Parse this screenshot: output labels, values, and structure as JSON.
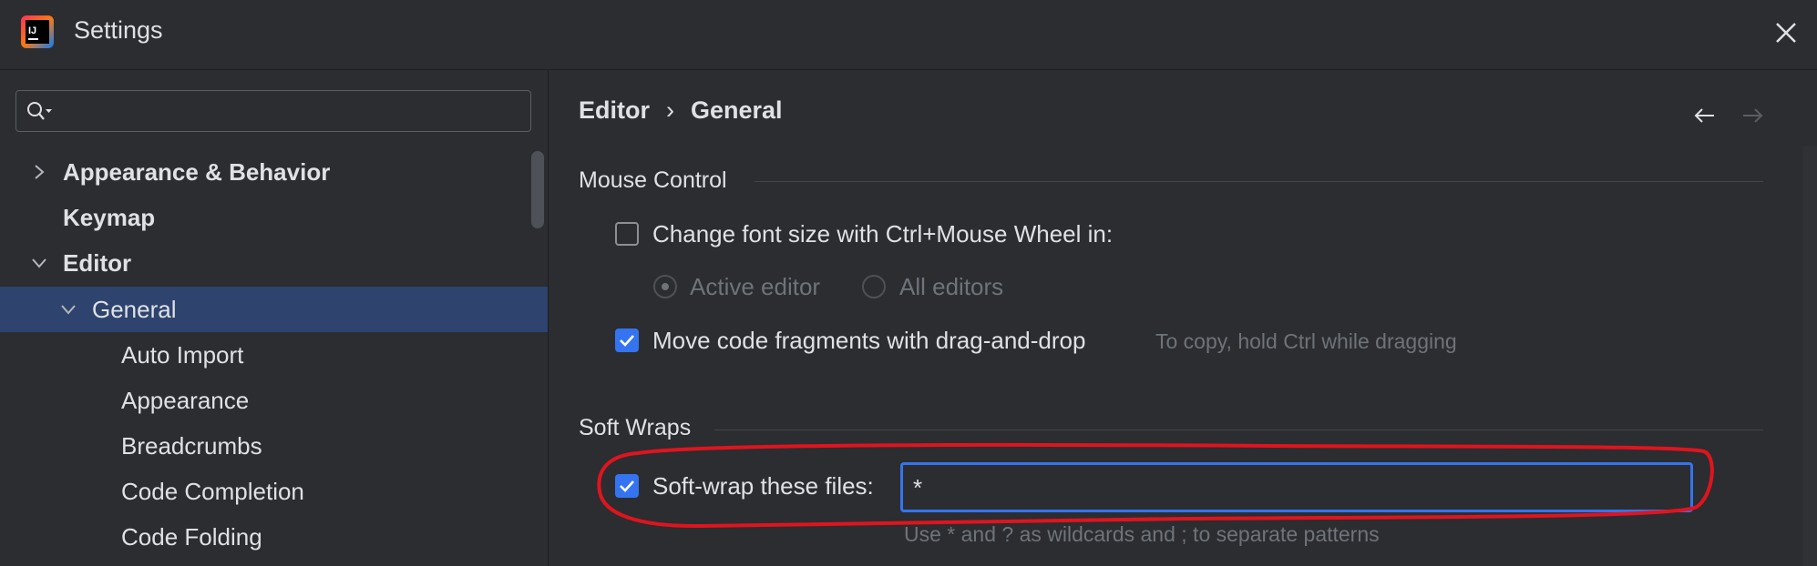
{
  "window": {
    "title": "Settings"
  },
  "search": {
    "placeholder": "",
    "value": ""
  },
  "sidebar": {
    "items": [
      {
        "label": "Appearance & Behavior",
        "expanded": false
      },
      {
        "label": "Keymap"
      },
      {
        "label": "Editor",
        "expanded": true
      },
      {
        "label": "General",
        "expanded": true,
        "selected": true
      },
      {
        "label": "Auto Import"
      },
      {
        "label": "Appearance"
      },
      {
        "label": "Breadcrumbs"
      },
      {
        "label": "Code Completion"
      },
      {
        "label": "Code Folding"
      }
    ]
  },
  "breadcrumb": {
    "parent": "Editor",
    "separator": "›",
    "current": "General"
  },
  "mouse_control": {
    "title": "Mouse Control",
    "font_size_checkbox": {
      "label": "Change font size with Ctrl+Mouse Wheel in:",
      "checked": false
    },
    "radio_active_editor": {
      "label": "Active editor",
      "selected": true,
      "enabled": false
    },
    "radio_all_editors": {
      "label": "All editors",
      "selected": false,
      "enabled": false
    },
    "drag_drop_checkbox": {
      "label": "Move code fragments with drag-and-drop",
      "checked": true
    },
    "drag_drop_hint": "To copy, hold Ctrl while dragging"
  },
  "soft_wraps": {
    "title": "Soft Wraps",
    "checkbox": {
      "label": "Soft-wrap these files:",
      "checked": true
    },
    "input_value": "*",
    "hint": "Use * and ? as wildcards and ; to separate patterns"
  },
  "colors": {
    "accent": "#3574f0",
    "selection": "#2e436e",
    "annotation": "#e0141e"
  },
  "icons": {
    "logo": "intellij-logo-icon",
    "close": "close-icon",
    "back": "arrow-left-icon",
    "forward": "arrow-right-icon",
    "search": "search-icon"
  }
}
